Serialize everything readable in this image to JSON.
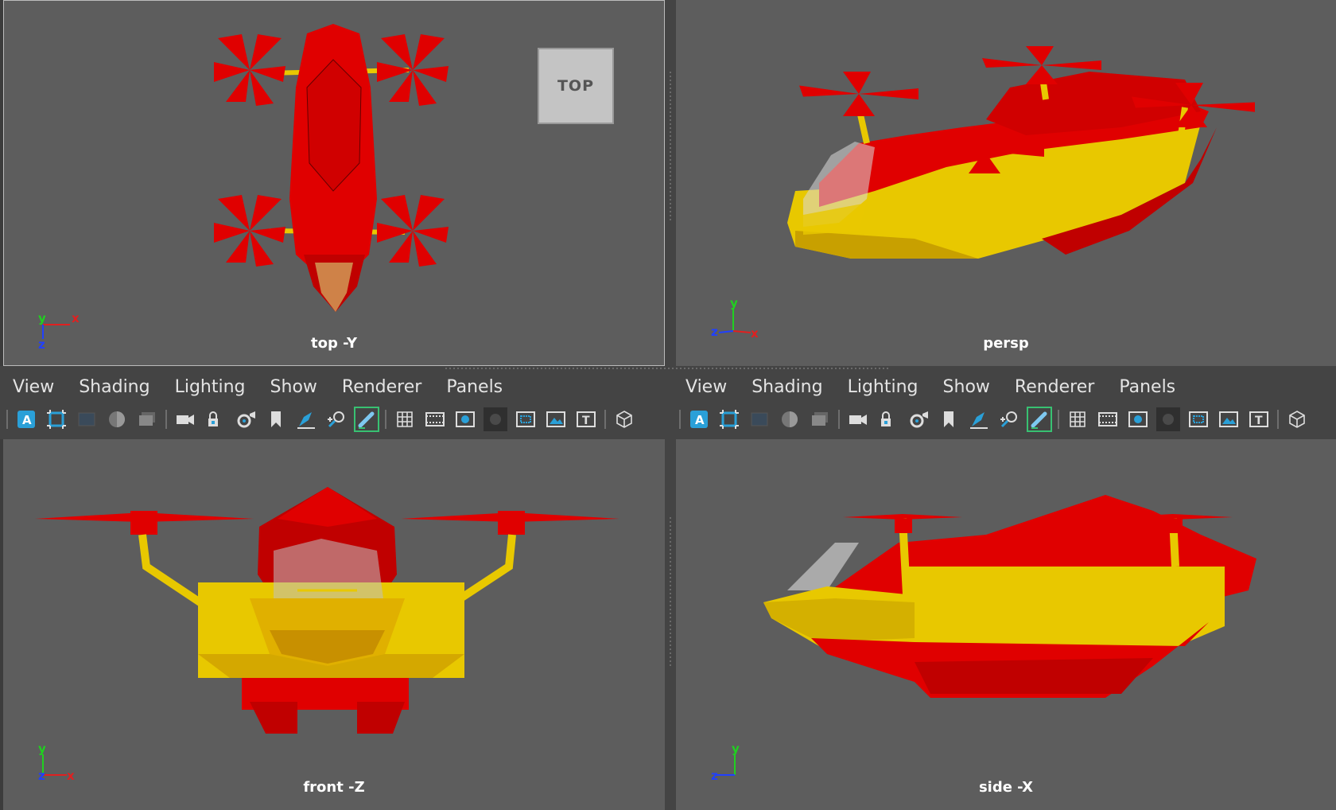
{
  "viewports": {
    "top": {
      "label": "top -Y",
      "axis": [
        "y",
        "x",
        "z"
      ],
      "cube_label": "TOP"
    },
    "persp": {
      "label": "persp",
      "axis": [
        "y",
        "z",
        "x"
      ]
    },
    "front": {
      "label": "front -Z",
      "axis": [
        "y",
        "z",
        "x"
      ]
    },
    "side": {
      "label": "side -X",
      "axis": [
        "y",
        "z"
      ]
    }
  },
  "menus": {
    "left": [
      "View",
      "Shading",
      "Lighting",
      "Show",
      "Renderer",
      "Panels"
    ],
    "right": [
      "View",
      "Shading",
      "Lighting",
      "Show",
      "Renderer",
      "Panels"
    ]
  },
  "toolbar_icons": [
    "select-camera-icon",
    "frame-icon",
    "grid-toggle-icon",
    "shading-ball-icon",
    "image-plane-icon",
    "camera-icon",
    "lock-camera-icon",
    "camera-attributes-icon",
    "bookmark-icon",
    "pen-tool-icon",
    "zoom-tool-icon",
    "paint-tool-icon",
    "grid-icon",
    "film-gate-icon",
    "resolution-gate-icon",
    "gate-mask-icon",
    "field-chart-icon",
    "safe-action-icon",
    "safe-title-icon",
    "wireframe-cube-icon"
  ],
  "colors": {
    "viewport_bg": "#5d5d5d",
    "model_red": "#d80000",
    "model_yellow": "#e8c800",
    "axis_x": "#e02020",
    "axis_y": "#20d020",
    "axis_z": "#2040ff"
  }
}
